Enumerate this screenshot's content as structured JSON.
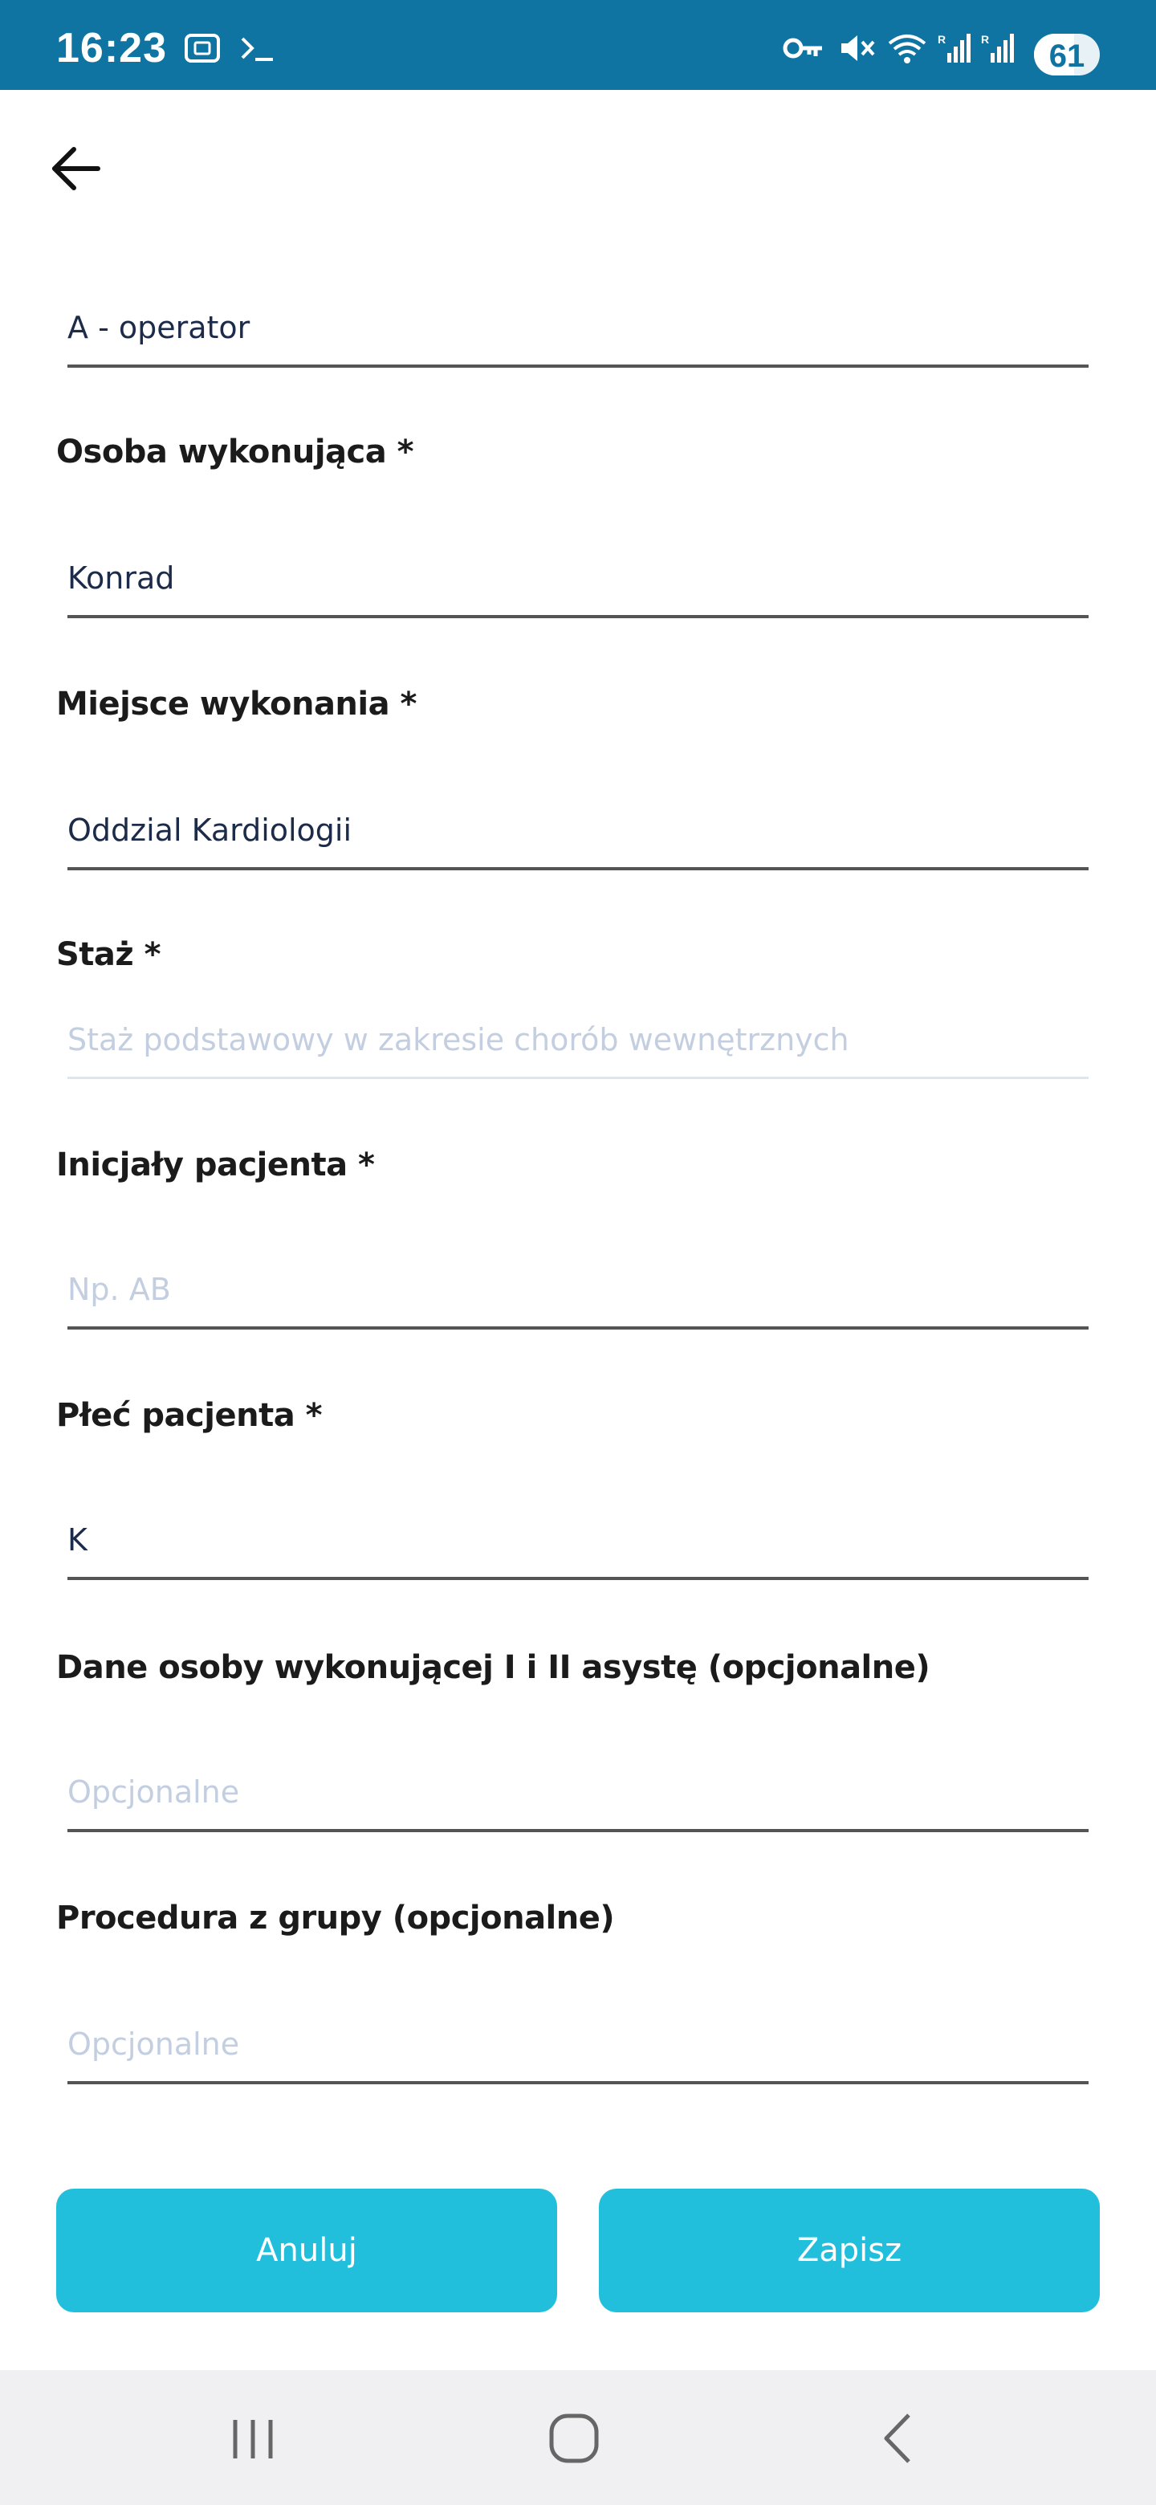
{
  "status_bar": {
    "time": "16:23",
    "battery_text": "61",
    "battery_level": 0.61,
    "icons": [
      "screenshot-icon",
      "terminal-icon",
      "vpn-key-icon",
      "mute-icon",
      "wifi-icon",
      "signal-icon",
      "signal-icon"
    ]
  },
  "header": {
    "back_icon": "arrow-left-icon"
  },
  "form": {
    "role": {
      "value": "A - operator"
    },
    "performer": {
      "label": "Osoba wykonująca *",
      "value": "Konrad"
    },
    "place": {
      "label": "Miejsce wykonania *",
      "value": "Oddzial Kardiologii"
    },
    "internship": {
      "label": "Staż *",
      "value": "",
      "placeholder": "Staż podstawowy w zakresie chorób wewnętrznych"
    },
    "patient_initials": {
      "label": "Inicjały pacjenta *",
      "value": "",
      "placeholder": "Np. AB"
    },
    "patient_sex": {
      "label": "Płeć pacjenta *",
      "value": "K"
    },
    "assistants": {
      "label": "Dane osoby wykonującej I i II asystę (opcjonalne)",
      "value": "",
      "placeholder": "Opcjonalne"
    },
    "group_procedure": {
      "label": "Procedura z grupy (opcjonalne)",
      "value": "",
      "placeholder": "Opcjonalne"
    }
  },
  "actions": {
    "cancel_label": "Anuluj",
    "save_label": "Zapisz"
  },
  "colors": {
    "status_bar": "#0f74a1",
    "button": "#22bfdd",
    "placeholder": "#c3cfe0",
    "input_text": "#1c2b4a"
  },
  "nav_bar": {
    "icons": [
      "recents-icon",
      "home-icon",
      "back-icon"
    ]
  }
}
